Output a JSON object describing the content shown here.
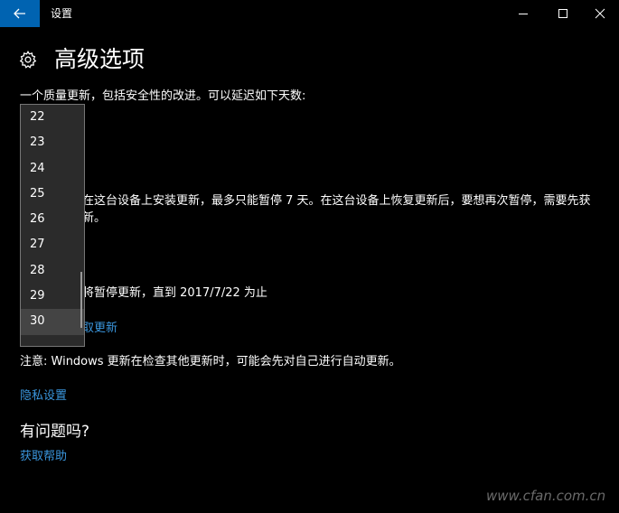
{
  "window": {
    "title": "设置",
    "controls": {
      "minimize": "minimize-icon",
      "maximize": "maximize-icon",
      "close": "close-icon"
    }
  },
  "header": {
    "icon": "gear-icon",
    "title": "高级选项"
  },
  "quality_update": {
    "description": "一个质量更新，包括安全性的改进。可以延迟如下天数:"
  },
  "dropdown": {
    "options": [
      "22",
      "23",
      "24",
      "25",
      "26",
      "27",
      "28",
      "29",
      "30"
    ],
    "selected": "30"
  },
  "pause": {
    "line1_visible": "在这台设备上安装更新，最多只能暂停 7 天。在这台设备上恢复更新后，要想再次暂停，需要先获",
    "line2_visible": "新。",
    "status_visible": "将暂停更新，直到 2017/7/22 为止",
    "link_visible": "取更新"
  },
  "note": "注意: Windows 更新在检查其他更新时，可能会先对自己进行自动更新。",
  "privacy_link": "隐私设置",
  "help": {
    "heading": "有问题吗?",
    "link": "获取帮助"
  },
  "watermark": "www.cfan.com.cn",
  "colors": {
    "accent": "#0063b1",
    "link": "#3a96dd",
    "background": "#000000",
    "dropdown_bg": "#2b2b2b",
    "dropdown_selected": "#444444"
  }
}
